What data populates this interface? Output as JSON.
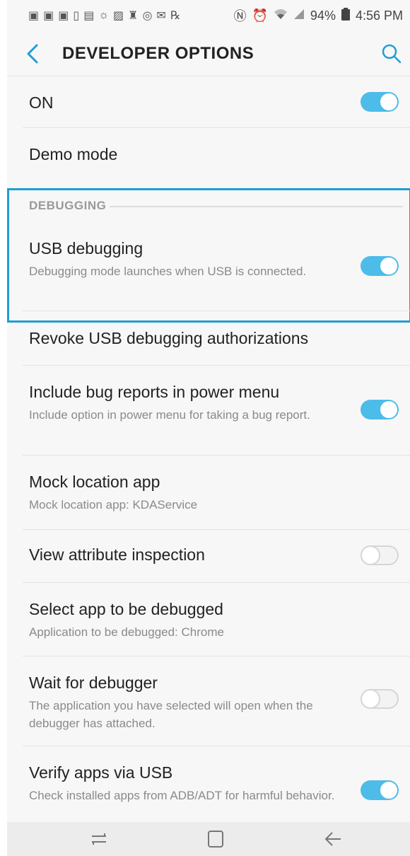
{
  "status_bar": {
    "left_icons": [
      "facebook-icon",
      "facebook-icon",
      "facebook-icon",
      "notes-icon",
      "image-icon",
      "weather-icon",
      "photo-icon",
      "game-icon",
      "instagram-icon",
      "mail-icon",
      "rx-icon"
    ],
    "battery": "94%",
    "time": "4:56 PM"
  },
  "app_bar": {
    "title": "DEVELOPER OPTIONS"
  },
  "master": {
    "label": "ON",
    "enabled": true
  },
  "demo_mode": {
    "label": "Demo mode"
  },
  "debugging_section": {
    "header": "DEBUGGING"
  },
  "usb_debugging": {
    "label": "USB debugging",
    "sub": "Debugging mode launches when USB is connected.",
    "enabled": true
  },
  "revoke": {
    "label": "Revoke USB debugging authorizations"
  },
  "bug_reports": {
    "label": "Include bug reports in power menu",
    "sub": "Include option in power menu for taking a bug report.",
    "enabled": true
  },
  "mock_location": {
    "label": "Mock location app",
    "sub": "Mock location app: KDAService"
  },
  "view_attribute": {
    "label": "View attribute inspection",
    "enabled": false
  },
  "select_app": {
    "label": "Select app to be debugged",
    "sub": "Application to be debugged: Chrome"
  },
  "wait_debugger": {
    "label": "Wait for debugger",
    "sub": "The application you have selected will open when the debugger has attached.",
    "enabled": false
  },
  "verify_usb": {
    "label": "Verify apps via USB",
    "sub": "Check installed apps from ADB/ADT for harmful behavior.",
    "enabled": true
  },
  "colors": {
    "accent": "#4dbce9",
    "highlight_border": "#1f9ed1",
    "background": "#f7f7f7"
  }
}
